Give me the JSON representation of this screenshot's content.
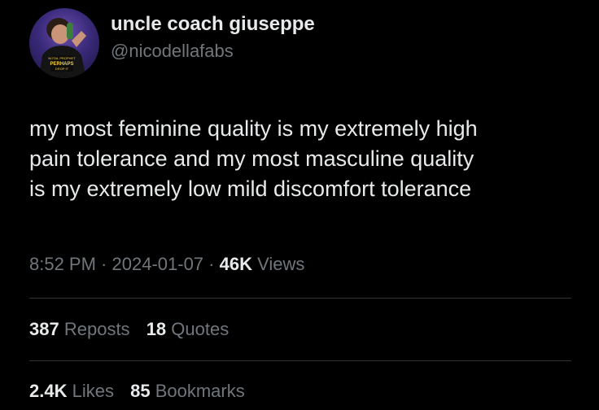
{
  "user": {
    "display_name": "uncle coach giuseppe",
    "handle": "@nicodellafabs",
    "avatar_shirt_text": "PERHAPS"
  },
  "tweet": {
    "lines": [
      "my most feminine quality is my extremely high",
      "pain tolerance and my most masculine quality",
      "is my extremely low mild discomfort tolerance"
    ]
  },
  "meta": {
    "time": "8:52 PM",
    "separator": " · ",
    "date": "2024-01-07",
    "views_count": "46K",
    "views_label": "Views"
  },
  "stats": {
    "reposts_count": "387",
    "reposts_label": "Reposts",
    "quotes_count": "18",
    "quotes_label": "Quotes",
    "likes_count": "2.4K",
    "likes_label": "Likes",
    "bookmarks_count": "85",
    "bookmarks_label": "Bookmarks"
  },
  "colors": {
    "background": "#000000",
    "primary_text": "#e7e9ea",
    "secondary_text": "#71767b",
    "divider": "#2f3336"
  }
}
